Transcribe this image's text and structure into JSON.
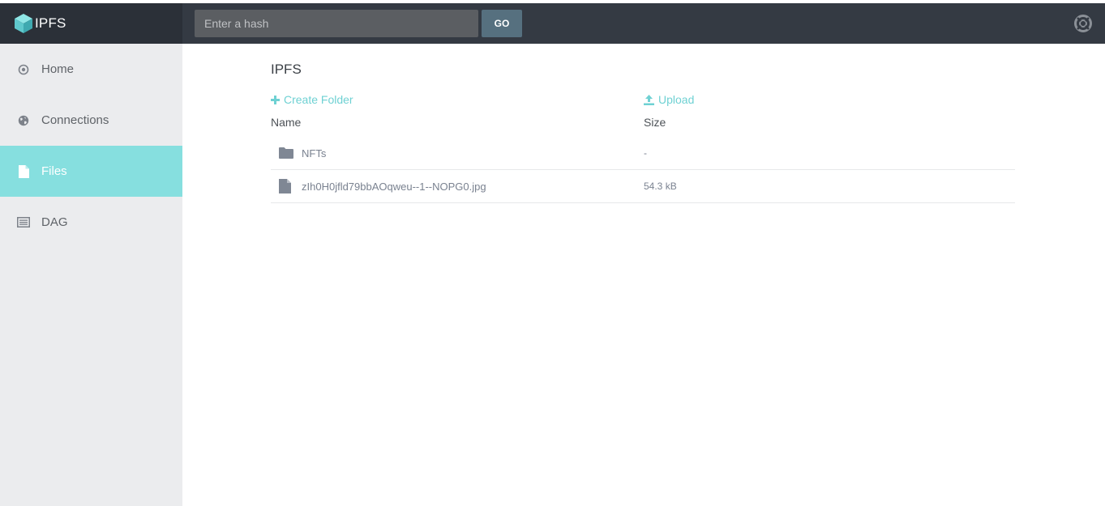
{
  "app": {
    "brand": "IPFS"
  },
  "search": {
    "placeholder": "Enter a hash",
    "button_label": "GO"
  },
  "sidebar": {
    "items": [
      {
        "label": "Home",
        "icon": "target-icon",
        "active": false
      },
      {
        "label": "Connections",
        "icon": "globe-icon",
        "active": false
      },
      {
        "label": "Files",
        "icon": "file-icon",
        "active": true
      },
      {
        "label": "DAG",
        "icon": "list-icon",
        "active": false
      }
    ]
  },
  "main": {
    "title": "IPFS",
    "create_folder_label": "Create Folder",
    "upload_label": "Upload",
    "columns": {
      "name": "Name",
      "size": "Size"
    },
    "files": [
      {
        "type": "folder",
        "name": "NFTs",
        "size": "-"
      },
      {
        "type": "file",
        "name": "zIh0H0jfld79bbAOqweu--1--NOPG0.jpg",
        "size": "54.3 kB"
      }
    ]
  },
  "colors": {
    "topbar": "#343a43",
    "accent": "#86dfdf",
    "link": "#6fd1d3",
    "sidebar": "#ebecee"
  }
}
